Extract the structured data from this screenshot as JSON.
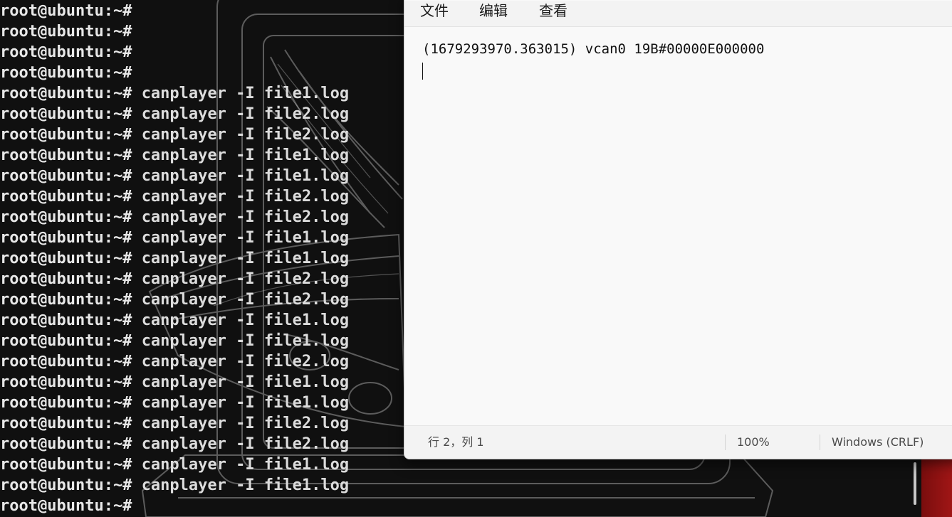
{
  "terminal": {
    "prompt": "root@ubuntu:~#",
    "lines": [
      "",
      "",
      "",
      "",
      "canplayer -I file1.log",
      "canplayer -I file2.log",
      "canplayer -I file2.log",
      "canplayer -I file1.log",
      "canplayer -I file1.log",
      "canplayer -I file2.log",
      "canplayer -I file2.log",
      "canplayer -I file1.log",
      "canplayer -I file1.log",
      "canplayer -I file2.log",
      "canplayer -I file2.log",
      "canplayer -I file1.log",
      "canplayer -I file1.log",
      "canplayer -I file2.log",
      "canplayer -I file1.log",
      "canplayer -I file1.log",
      "canplayer -I file2.log",
      "canplayer -I file2.log",
      "canplayer -I file1.log",
      "canplayer -I file1.log",
      ""
    ]
  },
  "notepad": {
    "menu": {
      "file": "文件",
      "edit": "编辑",
      "view": "查看"
    },
    "content": "(1679293970.363015) vcan0 19B#00000E000000",
    "status": {
      "position": "行 2，列 1",
      "zoom": "100%",
      "line_ending": "Windows (CRLF)"
    }
  },
  "colors": {
    "terminal_bg": "#101010",
    "terminal_text": "#e8e8e8",
    "notepad_bg": "#f9f9f9",
    "desktop_accent": "#a01616"
  }
}
